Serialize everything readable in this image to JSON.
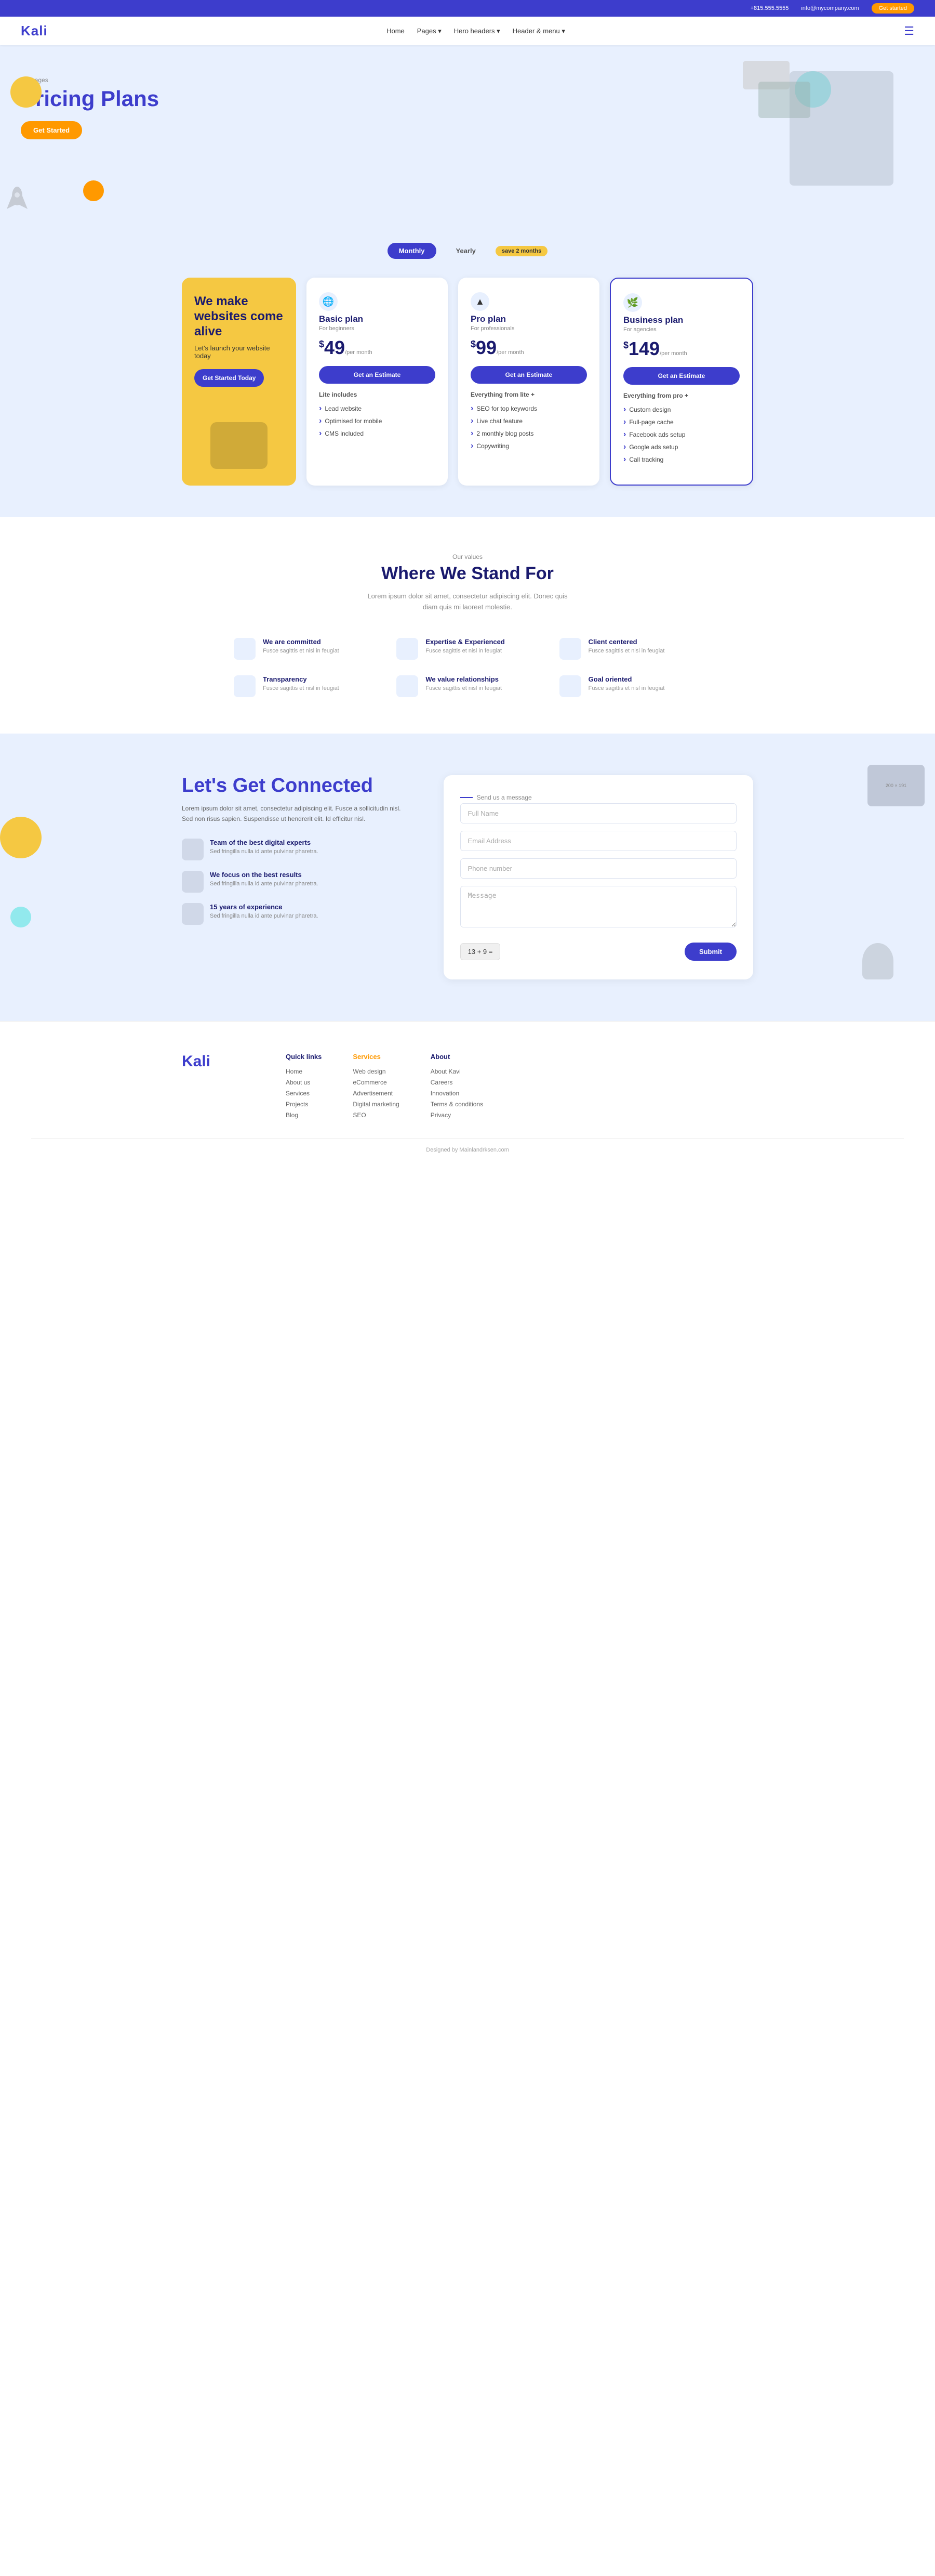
{
  "topbar": {
    "phone": "+815.555.5555",
    "email": "info@mycompany.com",
    "cta": "Get started"
  },
  "navbar": {
    "logo": "Kali",
    "links": [
      "Home",
      "Pages",
      "Hero headers",
      "Header & menu"
    ],
    "hamburger": "☰"
  },
  "hero": {
    "label": "Packages",
    "title": "Pricing Plans",
    "btn": "Get Started"
  },
  "pricing": {
    "toggle": {
      "monthly": "Monthly",
      "yearly": "Yearly",
      "save": "save 2 months"
    },
    "promo": {
      "title": "We make websites come alive",
      "subtitle": "Let's launch your website today",
      "btn": "Get Started Today"
    },
    "plans": [
      {
        "id": "basic",
        "icon": "🌐",
        "name": "Basic plan",
        "subtitle": "For beginners",
        "price": "49",
        "period": "/per month",
        "btn": "Get an Estimate",
        "includes_label": "Lite includes",
        "features": [
          "Lead website",
          "Optimised for mobile",
          "CMS included"
        ]
      },
      {
        "id": "pro",
        "icon": "▲",
        "name": "Pro plan",
        "subtitle": "For professionals",
        "price": "99",
        "period": "/per month",
        "btn": "Get an Estimate",
        "includes_label": "Everything from lite +",
        "features": [
          "SEO for top keywords",
          "Live chat feature",
          "2 monthly blog posts",
          "Copywriting"
        ]
      },
      {
        "id": "business",
        "icon": "🌿",
        "name": "Business plan",
        "subtitle": "For agencies",
        "price": "149",
        "period": "/per month",
        "btn": "Get an Estimate",
        "includes_label": "Everything from pro +",
        "features": [
          "Custom design",
          "Full-page cache",
          "Facebook ads setup",
          "Google ads setup",
          "Call tracking"
        ]
      }
    ]
  },
  "values": {
    "label": "Our values",
    "title": "Where We Stand For",
    "desc": "Lorem ipsum dolor sit amet, consectetur adipiscing elit. Donec quis diam quis mi laoreet molestie.",
    "items": [
      {
        "title": "We are committed",
        "desc": "Fusce sagittis et nisl in feugiat"
      },
      {
        "title": "Expertise & Experienced",
        "desc": "Fusce sagittis et nisl in feugiat"
      },
      {
        "title": "Client centered",
        "desc": "Fusce sagittis et nisl in feugiat"
      },
      {
        "title": "Transparency",
        "desc": "Fusce sagittis et nisl in feugiat"
      },
      {
        "title": "We value relationships",
        "desc": "Fusce sagittis et nisl in feugiat"
      },
      {
        "title": "Goal oriented",
        "desc": "Fusce sagittis et nisl in feugiat"
      }
    ]
  },
  "connect": {
    "title": "Let's Get Connected",
    "desc": "Lorem ipsum dolor sit amet, consectetur adipiscing elit. Fusce a sollicitudin nisl. Sed non risus sapien. Suspendisse ut hendrerit elit. Id efficitur nisl.",
    "features": [
      {
        "title": "Team of the best digital experts",
        "desc": "Sed fringilla nulla id ante pulvinar pharetra."
      },
      {
        "title": "We focus on the best results",
        "desc": "Sed fringilla nulla id ante pulvinar pharetra."
      },
      {
        "title": "15 years of experience",
        "desc": "Sed fringilla nulla id ante pulvinar pharetra."
      }
    ],
    "form": {
      "section_label": "Send us a message",
      "fields": {
        "fullname": "Full Name",
        "email": "Email Address",
        "phone": "Phone number",
        "message": "Message"
      },
      "captcha": "13 + 9 =",
      "submit": "Submit"
    }
  },
  "footer": {
    "logo": "Kali",
    "columns": [
      {
        "title": "Quick links",
        "items": [
          "Home",
          "About us",
          "Services",
          "Projects",
          "Blog"
        ]
      },
      {
        "title": "Services",
        "items": [
          "Web design",
          "eCommerce",
          "Advertisement",
          "Digital marketing",
          "SEO"
        ]
      },
      {
        "title": "About",
        "items": [
          "About Kavi",
          "Careers",
          "Innovation",
          "Terms & conditions",
          "Privacy"
        ]
      }
    ],
    "credit": "Designed by Mainlandrksen.com"
  }
}
